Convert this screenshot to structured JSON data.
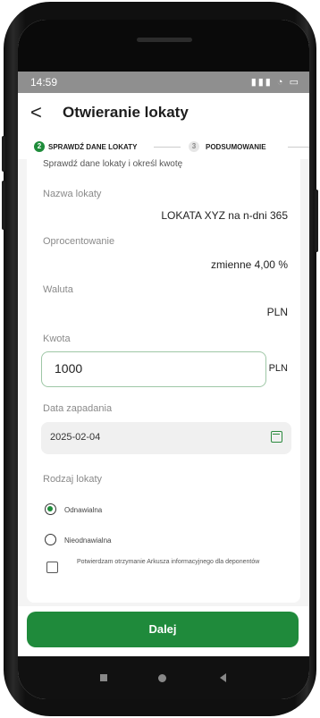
{
  "statusbar": {
    "time": "14:59",
    "icons": "aͰ ≈ ▭"
  },
  "header": {
    "back": "<",
    "title": "Otwieranie lokaty"
  },
  "steps": [
    {
      "num": "2",
      "label": "SPRAWDŹ DANE LOKATY"
    },
    {
      "num": "3",
      "label": "PODSUMOWANIE"
    }
  ],
  "intro": "Sprawdź dane lokaty i określ kwotę",
  "fields": {
    "name_label": "Nazwa lokaty",
    "name_value": "LOKATA XYZ na n-dni 365",
    "rate_label": "Oprocentowanie",
    "rate_value": "zmienne 4,00 %",
    "currency_label": "Waluta",
    "currency_value": "PLN",
    "amount_label": "Kwota",
    "amount_value": "1000",
    "amount_currency": "PLN",
    "date_label": "Data zapadania",
    "date_value": "2025-02-04",
    "type_label": "Rodzaj lokaty"
  },
  "radio": [
    {
      "label": "Odnawialna",
      "checked": true
    },
    {
      "label": "Nieodnawialna",
      "checked": false
    }
  ],
  "consent": "Potwierdzam otrzymanie Arkusza informacyjnego dla deponentów",
  "submit": "Dalej",
  "colors": {
    "accent": "#1f8a3b",
    "input_border": "#9ec7a6"
  }
}
